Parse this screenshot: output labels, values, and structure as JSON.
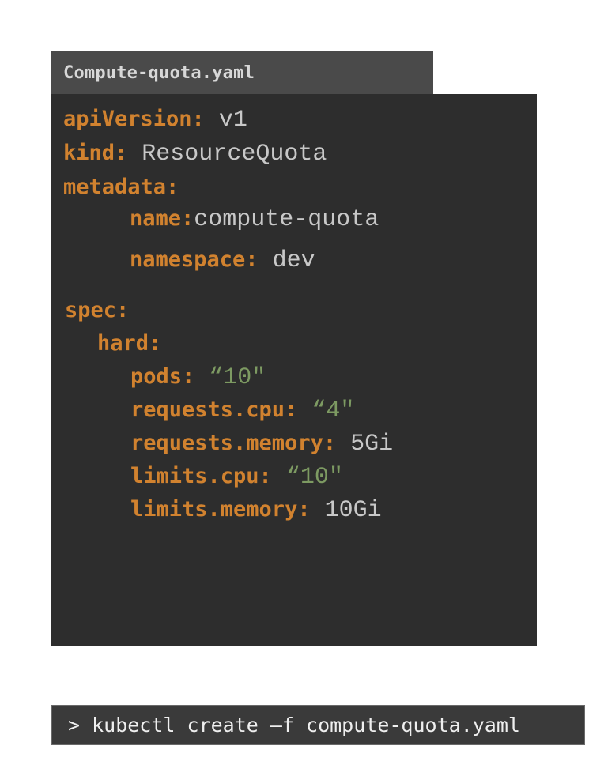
{
  "file_tab": {
    "filename": "Compute-quota.yaml"
  },
  "yaml": {
    "api_version": {
      "key": "apiVersion:",
      "value": "v1"
    },
    "kind": {
      "key": "kind:",
      "value": "ResourceQuota"
    },
    "metadata": {
      "key": "metadata:"
    },
    "name": {
      "key": "name:",
      "value": "compute-quota"
    },
    "namespace": {
      "key": "namespace:",
      "value": "dev"
    },
    "spec": {
      "key": "spec:"
    },
    "hard": {
      "key": "hard:"
    },
    "pods": {
      "key": "pods:",
      "value": "“10\""
    },
    "requests_cpu": {
      "key": "requests.cpu:",
      "value": "“4\""
    },
    "requests_memory": {
      "key": "requests.memory:",
      "value": "5Gi"
    },
    "limits_cpu": {
      "key": "limits.cpu:",
      "value": "“10\""
    },
    "limits_memory": {
      "key": "limits.memory:",
      "value": "10Gi"
    }
  },
  "terminal": {
    "command": "> kubectl create –f compute-quota.yaml"
  },
  "colors": {
    "key": "#d1822f",
    "value": "#c8c8c8",
    "string": "#7d9a62",
    "editor_bg": "#2d2d2d",
    "tab_bg": "#4a4a4a",
    "terminal_bg": "#3a3a3a"
  }
}
